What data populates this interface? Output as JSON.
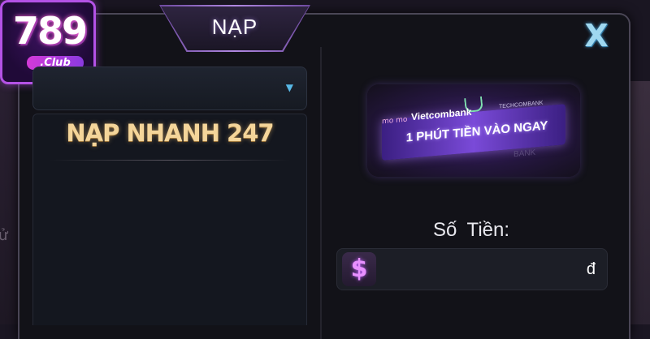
{
  "logo": {
    "number": "789",
    "sub": ".Club"
  },
  "modal": {
    "title": "NẠP",
    "close_symbol": "X"
  },
  "dropdown": {
    "selected": "",
    "arrow": "▼"
  },
  "methods": [
    {
      "label": "NẠP NHANH 247"
    }
  ],
  "banner": {
    "brand_momo": "mo mo",
    "brand_vietcombank": "Vietcombank",
    "brand_techcombank": "TECHCOMBANK",
    "tagline": "1 PHÚT TIỀN VÀO NGAY",
    "watermark": "BANK"
  },
  "amount": {
    "label": "Số Tiền:",
    "icon_symbol": "$",
    "value": "",
    "placeholder": "",
    "currency": "đ"
  },
  "background": {
    "left_partial_text": "ử"
  },
  "colors": {
    "accent_purple": "#b452e6",
    "method_gold": "#f4d59a",
    "close_blue": "#9fd8f0"
  }
}
